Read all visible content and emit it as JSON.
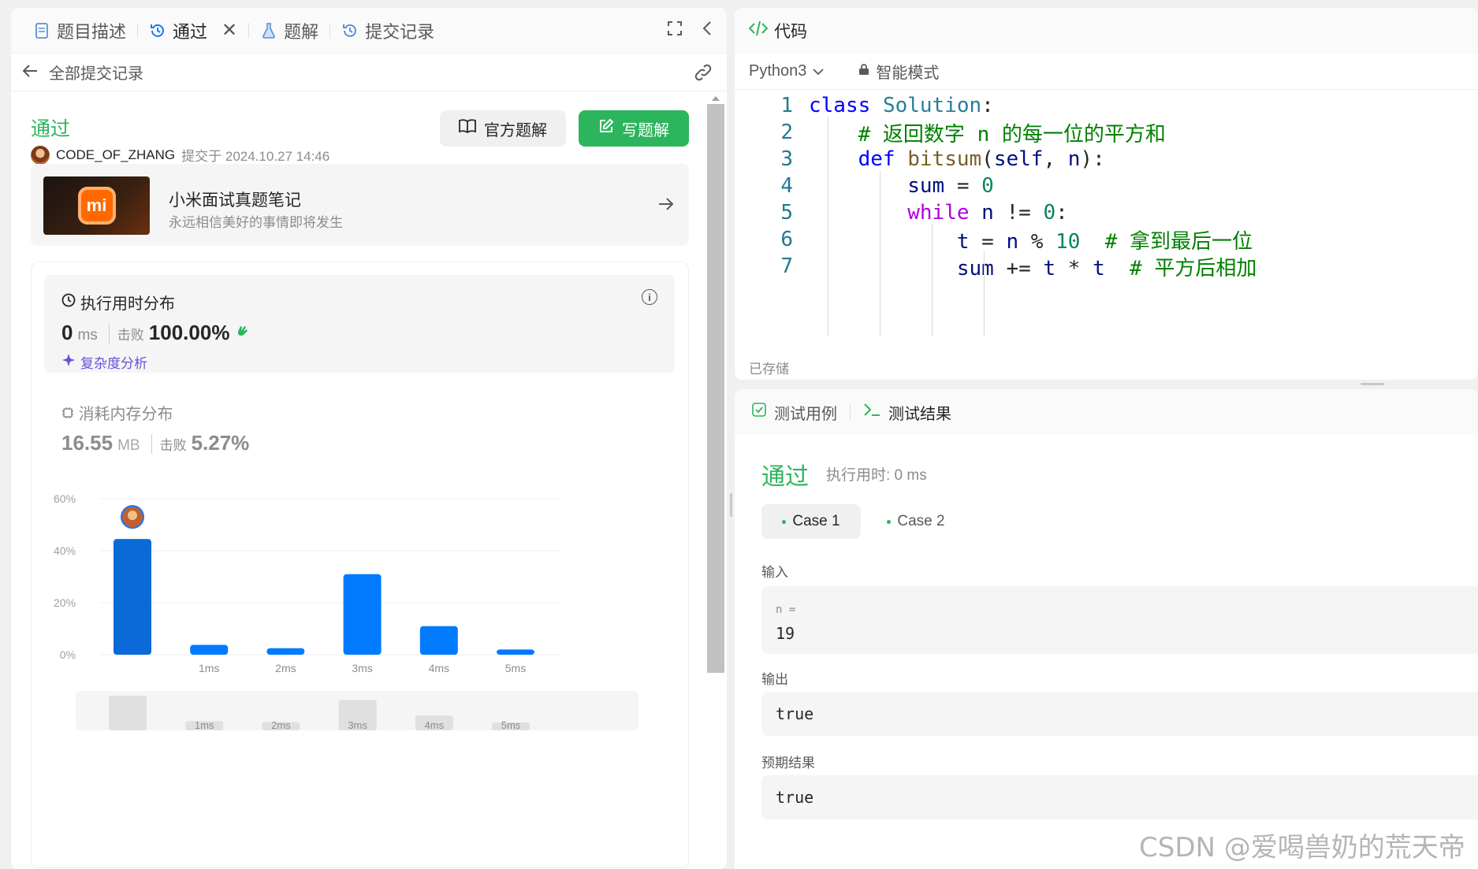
{
  "tabs": [
    {
      "label": "题目描述",
      "icon": "document-icon"
    },
    {
      "label": "通过",
      "icon": "history-icon",
      "active": true
    },
    {
      "label": "题解",
      "icon": "flask-icon"
    },
    {
      "label": "提交记录",
      "icon": "history-icon"
    }
  ],
  "subheader": {
    "back_label": "全部提交记录"
  },
  "submission": {
    "status": "通过",
    "author": "CODE_OF_ZHANG",
    "submitted_meta": "提交于 2024.10.27 14:46",
    "official_solution_label": "官方题解",
    "write_solution_label": "写题解"
  },
  "promo": {
    "title": "小米面试真题笔记",
    "subtitle": "永远相信美好的事情即将发生",
    "logo_text": "mi"
  },
  "runtime": {
    "title": "执行用时分布",
    "value": "0",
    "unit": "ms",
    "beat_label": "击败",
    "beat_value": "100.00%",
    "complexity_label": "复杂度分析"
  },
  "memory": {
    "title": "消耗内存分布",
    "value": "16.55",
    "unit": "MB",
    "beat_label": "击败",
    "beat_value": "5.27%"
  },
  "chart_data": {
    "type": "bar",
    "categories": [
      "0ms",
      "1ms",
      "2ms",
      "3ms",
      "4ms",
      "5ms"
    ],
    "tick_labels": [
      "",
      "1ms",
      "2ms",
      "3ms",
      "4ms",
      "5ms"
    ],
    "values": [
      44.5,
      3.8,
      2.5,
      31,
      11,
      2
    ],
    "ylim": [
      0,
      60
    ],
    "yticks": [
      "0%",
      "20%",
      "40%",
      "60%"
    ],
    "highlight_index": 0,
    "colors": {
      "bar": "#007aff",
      "highlight": "#0a6ad8",
      "grid": "#ececec"
    }
  },
  "code": {
    "header": "代码",
    "language": "Python3",
    "mode": "智能模式",
    "saved": "已存储",
    "lines": [
      "class Solution:",
      "    # 返回数字 n 的每一位的平方和",
      "    def bitsum(self, n):",
      "        sum = 0",
      "        while n != 0:",
      "            t = n % 10  # 拿到最后一位",
      "            sum += t * t  # 平方后相加"
    ]
  },
  "tests": {
    "tab_cases": "测试用例",
    "tab_result": "测试结果",
    "status": "通过",
    "runtime": "执行用时: 0 ms",
    "cases": [
      "Case 1",
      "Case 2"
    ],
    "input_label": "输入",
    "input_key": "n =",
    "input_value": "19",
    "output_label": "输出",
    "output_value": "true",
    "expected_label": "预期结果",
    "expected_value": "true"
  },
  "watermark": "CSDN @爱喝兽奶的荒天帝"
}
